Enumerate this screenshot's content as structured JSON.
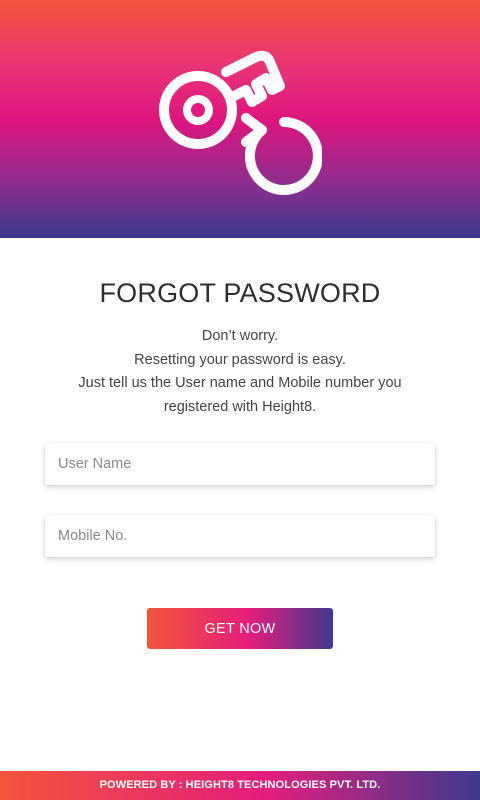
{
  "header": {
    "icon": "key-reset-icon"
  },
  "title": "FORGOT PASSWORD",
  "description": {
    "line1": "Don’t worry.",
    "line2": "Resetting your password is easy.",
    "line3": "Just tell us the User name and Mobile number you",
    "line4": "registered with Height8."
  },
  "form": {
    "username_placeholder": "User Name",
    "username_value": "",
    "mobile_placeholder": "Mobile No.",
    "mobile_value": "",
    "submit_label": "GET NOW"
  },
  "footer": {
    "text": "POWERED BY : HEIGHT8 TECHNOLOGIES PVT. LTD."
  },
  "colors": {
    "gradient_start": "#f2553b",
    "gradient_mid": "#e51e7c",
    "gradient_end": "#3d3a8f"
  }
}
